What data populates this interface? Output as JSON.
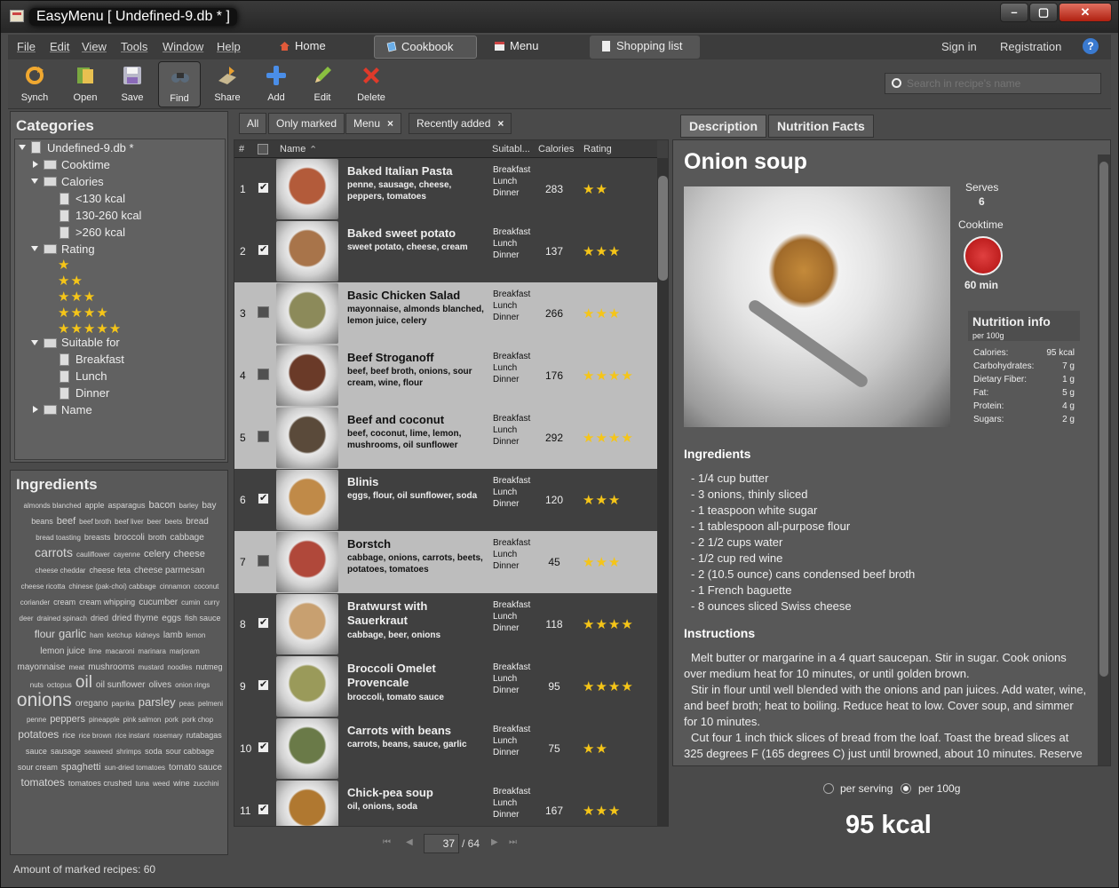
{
  "window": {
    "title": "EasyMenu [ Undefined-9.db * ]",
    "min": "–",
    "max": "▢",
    "close": "✕"
  },
  "menu": [
    "File",
    "Edit",
    "View",
    "Tools",
    "Window",
    "Help"
  ],
  "nav_tabs": [
    {
      "label": "Home",
      "icon": "home-icon"
    },
    {
      "label": "Cookbook",
      "icon": "cookbook-icon",
      "active": true
    },
    {
      "label": "Menu",
      "icon": "menu-icon"
    },
    {
      "label": "Shopping list",
      "icon": "shopping-list-icon"
    }
  ],
  "top_links": {
    "sign_in": "Sign in",
    "registration": "Registration",
    "help": "?"
  },
  "toolbar": [
    {
      "label": "Synch",
      "icon": "sync-icon"
    },
    {
      "label": "Open",
      "icon": "open-icon"
    },
    {
      "label": "Save",
      "icon": "save-icon"
    },
    {
      "label": "Find",
      "icon": "binoculars-icon",
      "active": true
    },
    {
      "label": "Share",
      "icon": "share-icon"
    },
    {
      "label": "Add",
      "icon": "plus-icon"
    },
    {
      "label": "Edit",
      "icon": "pencil-icon"
    },
    {
      "label": "Delete",
      "icon": "delete-icon"
    }
  ],
  "search": {
    "placeholder": "Search in recipe's name"
  },
  "categories": {
    "title": "Categories",
    "db": "Undefined-9.db *",
    "cooktime": "Cooktime",
    "calories": "Calories",
    "cal_items": [
      "<130 kcal",
      "130-260 kcal",
      ">260 kcal"
    ],
    "rating": "Rating",
    "rating_levels": [
      1,
      2,
      3,
      4,
      5
    ],
    "suitable": "Suitable for",
    "suitable_items": [
      "Breakfast",
      "Lunch",
      "Dinner"
    ],
    "name": "Name"
  },
  "ingredients_cloud": {
    "title": "Ingredients",
    "words": [
      {
        "w": "almonds blanched",
        "s": 8
      },
      {
        "w": "apple",
        "s": 9
      },
      {
        "w": "asparagus",
        "s": 9
      },
      {
        "w": "bacon",
        "s": 11
      },
      {
        "w": "barley",
        "s": 8
      },
      {
        "w": "bay",
        "s": 10
      },
      {
        "w": "beans",
        "s": 9
      },
      {
        "w": "beef",
        "s": 11
      },
      {
        "w": "beef broth",
        "s": 8
      },
      {
        "w": "beef liver",
        "s": 8
      },
      {
        "w": "beer",
        "s": 8
      },
      {
        "w": "beets",
        "s": 8
      },
      {
        "w": "bread",
        "s": 10
      },
      {
        "w": "bread toasting",
        "s": 8
      },
      {
        "w": "breasts",
        "s": 9
      },
      {
        "w": "broccoli",
        "s": 10
      },
      {
        "w": "broth",
        "s": 9
      },
      {
        "w": "cabbage",
        "s": 10
      },
      {
        "w": "carrots",
        "s": 14
      },
      {
        "w": "cauliflower",
        "s": 8
      },
      {
        "w": "cayenne",
        "s": 8
      },
      {
        "w": "celery",
        "s": 11
      },
      {
        "w": "cheese",
        "s": 11
      },
      {
        "w": "cheese cheddar",
        "s": 8
      },
      {
        "w": "cheese feta",
        "s": 9
      },
      {
        "w": "cheese parmesan",
        "s": 10
      },
      {
        "w": "cheese ricotta",
        "s": 8
      },
      {
        "w": "chinese (pak-choi) cabbage",
        "s": 8
      },
      {
        "w": "cinnamon",
        "s": 8
      },
      {
        "w": "coconut",
        "s": 8
      },
      {
        "w": "coriander",
        "s": 8
      },
      {
        "w": "cream",
        "s": 9
      },
      {
        "w": "cream whipping",
        "s": 9
      },
      {
        "w": "cucumber",
        "s": 10
      },
      {
        "w": "cumin",
        "s": 8
      },
      {
        "w": "curry",
        "s": 8
      },
      {
        "w": "deer",
        "s": 8
      },
      {
        "w": "drained spinach",
        "s": 8
      },
      {
        "w": "dried",
        "s": 9
      },
      {
        "w": "dried thyme",
        "s": 10
      },
      {
        "w": "eggs",
        "s": 10
      },
      {
        "w": "fish sauce",
        "s": 9
      },
      {
        "w": "flour",
        "s": 12
      },
      {
        "w": "garlic",
        "s": 13
      },
      {
        "w": "ham",
        "s": 8
      },
      {
        "w": "ketchup",
        "s": 8
      },
      {
        "w": "kidneys",
        "s": 8
      },
      {
        "w": "lamb",
        "s": 10
      },
      {
        "w": "lemon",
        "s": 8
      },
      {
        "w": "lemon juice",
        "s": 10
      },
      {
        "w": "lime",
        "s": 8
      },
      {
        "w": "macaroni",
        "s": 8
      },
      {
        "w": "marinara",
        "s": 8
      },
      {
        "w": "marjoram",
        "s": 8
      },
      {
        "w": "mayonnaise",
        "s": 10
      },
      {
        "w": "meat",
        "s": 8
      },
      {
        "w": "mushrooms",
        "s": 10
      },
      {
        "w": "mustard",
        "s": 8
      },
      {
        "w": "noodles",
        "s": 8
      },
      {
        "w": "nutmeg",
        "s": 9
      },
      {
        "w": "nuts",
        "s": 8
      },
      {
        "w": "octopus",
        "s": 8
      },
      {
        "w": "oil",
        "s": 19
      },
      {
        "w": "oil sunflower",
        "s": 10
      },
      {
        "w": "olives",
        "s": 10
      },
      {
        "w": "onion rings",
        "s": 8
      },
      {
        "w": "onions",
        "s": 21
      },
      {
        "w": "oregano",
        "s": 10
      },
      {
        "w": "paprika",
        "s": 8
      },
      {
        "w": "parsley",
        "s": 13
      },
      {
        "w": "peas",
        "s": 8
      },
      {
        "w": "pelmeni",
        "s": 8
      },
      {
        "w": "penne",
        "s": 8
      },
      {
        "w": "peppers",
        "s": 11
      },
      {
        "w": "pineapple",
        "s": 8
      },
      {
        "w": "pink salmon",
        "s": 8
      },
      {
        "w": "pork",
        "s": 8
      },
      {
        "w": "pork chop",
        "s": 8
      },
      {
        "w": "potatoes",
        "s": 12
      },
      {
        "w": "rice",
        "s": 9
      },
      {
        "w": "rice brown",
        "s": 8
      },
      {
        "w": "rice instant",
        "s": 8
      },
      {
        "w": "rosemary",
        "s": 8
      },
      {
        "w": "rutabagas",
        "s": 9
      },
      {
        "w": "sauce",
        "s": 9
      },
      {
        "w": "sausage",
        "s": 9
      },
      {
        "w": "seaweed",
        "s": 8
      },
      {
        "w": "shrimps",
        "s": 8
      },
      {
        "w": "soda",
        "s": 9
      },
      {
        "w": "sour cabbage",
        "s": 9
      },
      {
        "w": "sour cream",
        "s": 9
      },
      {
        "w": "spaghetti",
        "s": 11
      },
      {
        "w": "sun-dried tomatoes",
        "s": 8
      },
      {
        "w": "tomato sauce",
        "s": 10
      },
      {
        "w": "tomatoes",
        "s": 12
      },
      {
        "w": "tomatoes crushed",
        "s": 9
      },
      {
        "w": "tuna",
        "s": 8
      },
      {
        "w": "weed",
        "s": 8
      },
      {
        "w": "wine",
        "s": 9
      },
      {
        "w": "zucchini",
        "s": 8
      }
    ]
  },
  "status": "Amount of marked recipes: 60",
  "filter_tabs": [
    {
      "label": "All",
      "closable": false
    },
    {
      "label": "Only marked",
      "closable": false
    },
    {
      "label": "Menu",
      "closable": true
    },
    {
      "label": "Recently added",
      "closable": true
    }
  ],
  "list_header": {
    "num": "#",
    "name": "Name",
    "suitable": "Suitabl...",
    "calories": "Calories",
    "rating": "Rating"
  },
  "recipes": [
    {
      "n": "1",
      "checked": true,
      "title": "Baked Italian Pasta",
      "ingredients": "penne, sausage, cheese, peppers, tomatoes",
      "suitable": [
        "Breakfast",
        "Lunch",
        "Dinner"
      ],
      "calories": "283",
      "rating": 2,
      "light": false,
      "thumb": "#b35b3a"
    },
    {
      "n": "2",
      "checked": true,
      "title": "Baked sweet potato",
      "ingredients": "sweet potato, cheese, cream",
      "suitable": [
        "Breakfast",
        "Lunch",
        "Dinner"
      ],
      "calories": "137",
      "rating": 3,
      "light": false,
      "thumb": "#a8744a"
    },
    {
      "n": "3",
      "checked": false,
      "title": "Basic Chicken Salad",
      "ingredients": "mayonnaise, almonds blanched, lemon juice, celery",
      "suitable": [
        "Breakfast",
        "Lunch",
        "Dinner"
      ],
      "calories": "266",
      "rating": 3,
      "light": true,
      "thumb": "#8c8a5a"
    },
    {
      "n": "4",
      "checked": false,
      "title": "Beef Stroganoff",
      "ingredients": "beef, beef broth, onions, sour cream, wine, flour",
      "suitable": [
        "Breakfast",
        "Lunch",
        "Dinner"
      ],
      "calories": "176",
      "rating": 4,
      "light": true,
      "thumb": "#6a3a28"
    },
    {
      "n": "5",
      "checked": false,
      "title": "Beef and coconut",
      "ingredients": "beef, coconut, lime, lemon, mushrooms, oil sunflower",
      "suitable": [
        "Breakfast",
        "Lunch",
        "Dinner"
      ],
      "calories": "292",
      "rating": 4,
      "light": true,
      "thumb": "#5a4a3a"
    },
    {
      "n": "6",
      "checked": true,
      "title": "Blinis",
      "ingredients": "eggs, flour, oil sunflower, soda",
      "suitable": [
        "Breakfast",
        "Lunch",
        "Dinner"
      ],
      "calories": "120",
      "rating": 3,
      "light": false,
      "thumb": "#c08a48"
    },
    {
      "n": "7",
      "checked": false,
      "title": "Borstch",
      "ingredients": "cabbage, onions, carrots, beets, potatoes, tomatoes",
      "suitable": [
        "Breakfast",
        "Lunch",
        "Dinner"
      ],
      "calories": "45",
      "rating": 3,
      "light": true,
      "thumb": "#b0483a"
    },
    {
      "n": "8",
      "checked": true,
      "title": "Bratwurst with Sauerkraut",
      "ingredients": "cabbage, beer, onions",
      "suitable": [
        "Breakfast",
        "Lunch",
        "Dinner"
      ],
      "calories": "118",
      "rating": 4,
      "light": false,
      "thumb": "#c8a070"
    },
    {
      "n": "9",
      "checked": true,
      "title": "Broccoli Omelet Provencale",
      "ingredients": "broccoli, tomato sauce",
      "suitable": [
        "Breakfast",
        "Lunch",
        "Dinner"
      ],
      "calories": "95",
      "rating": 4,
      "light": false,
      "thumb": "#9a9a5a"
    },
    {
      "n": "10",
      "checked": true,
      "title": "Carrots with beans",
      "ingredients": "carrots, beans, sauce, garlic",
      "suitable": [
        "Breakfast",
        "Lunch",
        "Dinner"
      ],
      "calories": "75",
      "rating": 2,
      "light": false,
      "thumb": "#6a7a48"
    },
    {
      "n": "11",
      "checked": true,
      "title": "Chick-pea soup",
      "ingredients": "oil, onions, soda",
      "suitable": [
        "Breakfast",
        "Lunch",
        "Dinner"
      ],
      "calories": "167",
      "rating": 3,
      "light": false,
      "thumb": "#b07830"
    }
  ],
  "pager": {
    "first": "⏮",
    "prev": "◀",
    "current": "37",
    "total": "/ 64",
    "next": "▶",
    "last": "⏭"
  },
  "detail_tabs": [
    {
      "label": "Description",
      "active": true
    },
    {
      "label": "Nutrition Facts",
      "active": false
    }
  ],
  "recipe": {
    "title": "Onion soup",
    "serves_label": "Serves",
    "serves": "6",
    "cooktime_label": "Cooktime",
    "cooktime": "60 min",
    "nutrition_title": "Nutrition info",
    "nutrition_sub": "per 100g",
    "nutrition": [
      {
        "k": "Calories:",
        "v": "95 kcal"
      },
      {
        "k": "Carbohydrates:",
        "v": "7 g"
      },
      {
        "k": "Dietary Fiber:",
        "v": "1 g"
      },
      {
        "k": "Fat:",
        "v": "5 g"
      },
      {
        "k": "Protein:",
        "v": "4 g"
      },
      {
        "k": "Sugars:",
        "v": "2 g"
      }
    ],
    "ingredients_title": "Ingredients",
    "ingredients": [
      "- 1/4 cup butter",
      "- 3 onions, thinly sliced",
      "- 1 teaspoon white sugar",
      "- 1 tablespoon all-purpose flour",
      "- 2 1/2 cups water",
      "- 1/2 cup red wine",
      "- 2 (10.5 ounce) cans condensed beef broth",
      "- 1 French baguette",
      "- 8 ounces sliced Swiss cheese"
    ],
    "instructions_title": "Instructions",
    "instructions": [
      "  Melt butter or margarine in a 4 quart saucepan. Stir in sugar. Cook onions over medium heat for 10 minutes, or until golden brown.",
      "  Stir in flour until well blended with the onions and pan juices. Add water, wine, and beef broth; heat to boiling. Reduce heat to low. Cover soup, and simmer for 10 minutes.",
      "  Cut four 1 inch thick slices of bread from the loaf. Toast the bread slices at 325 degrees F (165 degrees C) just until browned, about 10 minutes. Reserve"
    ]
  },
  "units": {
    "per_serving": "per serving",
    "per_100g": "per 100g",
    "selected": "per_100g",
    "kcal": "95 kcal"
  },
  "colors": {
    "star": "#f5c518",
    "row_light": "#bdbdbd",
    "row_dark": "#404040"
  }
}
